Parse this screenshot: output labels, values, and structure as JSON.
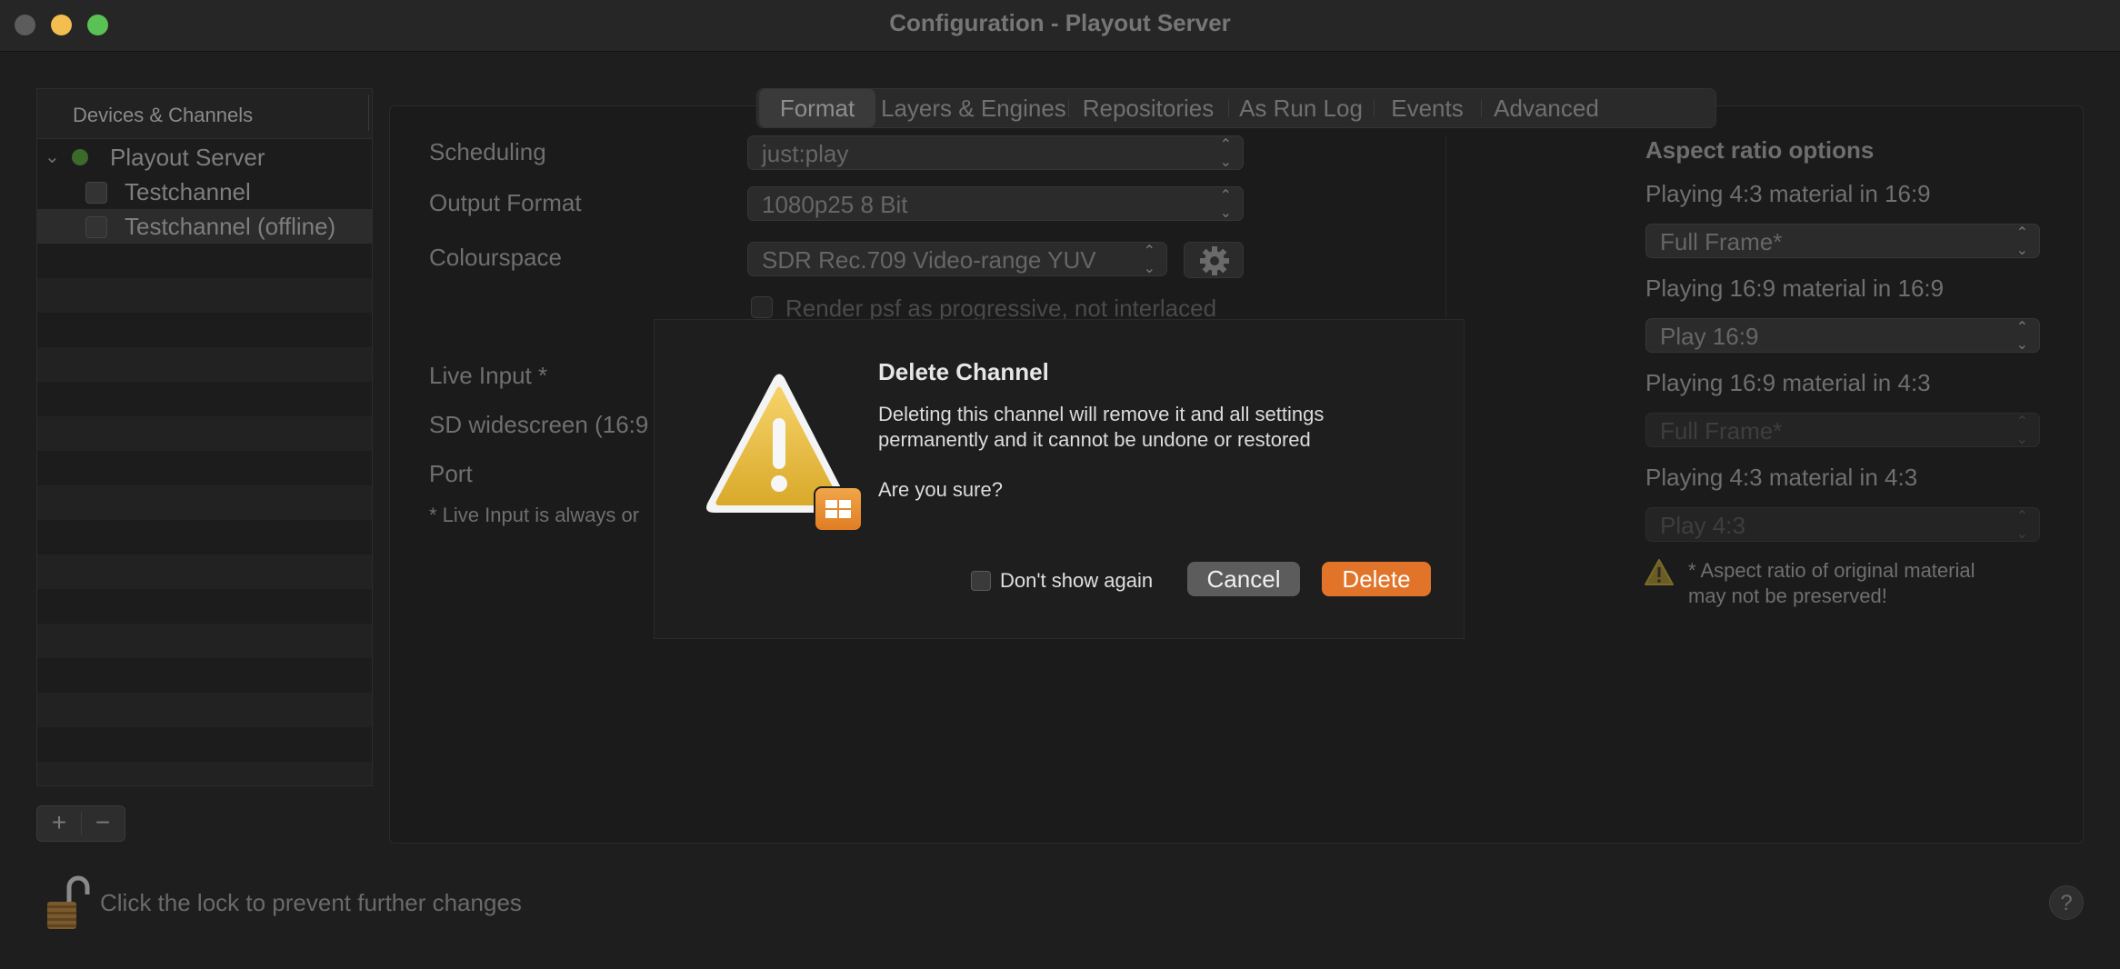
{
  "window": {
    "title": "Configuration - Playout Server"
  },
  "sidebar": {
    "header": "Devices & Channels",
    "items": [
      {
        "label": "Playout Server",
        "status": "online",
        "expanded": true
      },
      {
        "label": "Testchannel"
      },
      {
        "label": "Testchannel (offline)",
        "selected": true
      }
    ],
    "add_label": "+",
    "remove_label": "−"
  },
  "tabs": [
    {
      "label": "Format",
      "active": true
    },
    {
      "label": "Layers & Engines"
    },
    {
      "label": "Repositories"
    },
    {
      "label": "As Run Log"
    },
    {
      "label": "Events"
    },
    {
      "label": "Advanced"
    }
  ],
  "format": {
    "scheduling_label": "Scheduling",
    "scheduling_value": "just:play",
    "output_format_label": "Output Format",
    "output_format_value": "1080p25 8 Bit",
    "colourspace_label": "Colourspace",
    "colourspace_value": "SDR Rec.709 Video-range YUV",
    "render_psf_label": "Render psf as progressive, not interlaced",
    "live_input_label": "Live Input *",
    "sd_widescreen_label": "SD widescreen (16:9",
    "port_label": "Port",
    "live_input_note": "* Live Input is always or"
  },
  "aspect_ratio": {
    "title": "Aspect ratio options",
    "rows": [
      {
        "label": "Playing 4:3 material in 16:9",
        "value": "Full Frame*",
        "enabled": true
      },
      {
        "label": "Playing 16:9 material in 16:9",
        "value": "Play 16:9",
        "enabled": true
      },
      {
        "label": "Playing 16:9 material in 4:3",
        "value": "Full Frame*",
        "enabled": false
      },
      {
        "label": "Playing 4:3 material in 4:3",
        "value": "Play 4:3",
        "enabled": false
      }
    ],
    "note_line1": "* Aspect ratio of original material",
    "note_line2": "may not be preserved!"
  },
  "footer": {
    "lock_text": "Click the lock to prevent further changes",
    "help_label": "?"
  },
  "dialog": {
    "title": "Delete Channel",
    "message_line1": "Deleting this channel will remove it and all settings",
    "message_line2": "permanently and it cannot be undone or restored",
    "question": "Are you sure?",
    "dont_show_label": "Don't show again",
    "cancel_label": "Cancel",
    "delete_label": "Delete"
  },
  "icons": {
    "window_close": "close-icon",
    "window_minimize": "minimize-icon",
    "window_maximize": "maximize-icon",
    "disclosure": "chevron-down-icon",
    "status": "status-dot-icon",
    "gear": "gear-icon",
    "warning": "warning-icon",
    "lock": "unlocked-padlock-icon",
    "help": "question-mark-icon"
  },
  "colors": {
    "status_online": "#3b6a2a",
    "delete_button": "#e2742a",
    "warning_yellow": "#f1c232",
    "light_close": "#5c5c5c",
    "light_minimize": "#f3bd4f",
    "light_maximize": "#5ac155"
  }
}
